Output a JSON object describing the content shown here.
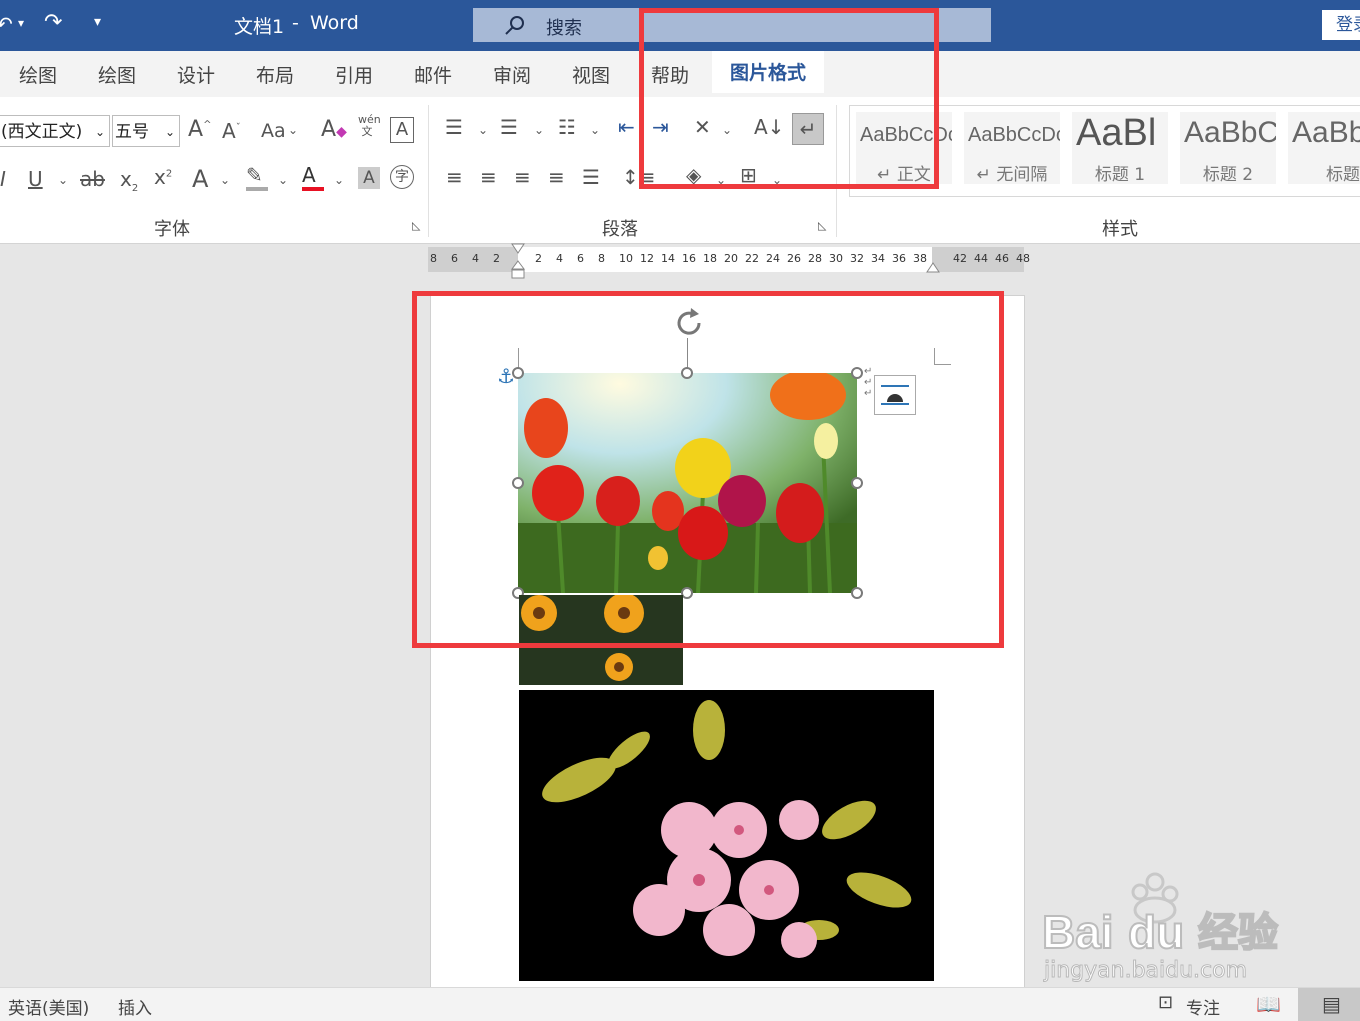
{
  "title_bar": {
    "doc_name": "文档1",
    "separator": "-",
    "app_name": "Word",
    "search_placeholder": "搜索",
    "login_label": "登录"
  },
  "tabs": [
    "绘图",
    "绘图",
    "设计",
    "布局",
    "引用",
    "邮件",
    "审阅",
    "视图",
    "帮助",
    "图片格式"
  ],
  "active_tab": "图片格式",
  "font_group": {
    "font_name": "(西文正文)",
    "font_size": "五号",
    "label": "字体",
    "case_button": "Aa",
    "phonetic": "wén"
  },
  "paragraph_group": {
    "label": "段落"
  },
  "styles_group": {
    "label": "样式",
    "styles": [
      {
        "preview": "AaBbCcDc",
        "name": "正文"
      },
      {
        "preview": "AaBbCcDc",
        "name": "无间隔"
      },
      {
        "preview": "AaBl",
        "name": "标题 1"
      },
      {
        "preview": "AaBbC",
        "name": "标题 2"
      },
      {
        "preview": "AaBb",
        "name": "标题"
      }
    ]
  },
  "ruler": {
    "left_ticks": [
      "8",
      "6",
      "4",
      "2"
    ],
    "mid_ticks": [
      "2",
      "4",
      "6",
      "8",
      "10",
      "12",
      "14",
      "16",
      "18",
      "20",
      "22",
      "24",
      "26",
      "28",
      "30",
      "32",
      "34",
      "36",
      "38"
    ],
    "right_ticks": [
      "42",
      "44",
      "46",
      "48"
    ]
  },
  "status_bar": {
    "language": "英语(美国)",
    "mode": "插入",
    "focus": "专注"
  },
  "watermark": {
    "brand": "Bai du 经验",
    "url": "jingyan.baidu.com"
  },
  "colors": {
    "title_blue": "#2b579a",
    "highlight_red": "#ee3a3d",
    "font_color_bar": "#e81123"
  },
  "icons": [
    "undo-icon",
    "redo-icon",
    "customize-icon",
    "search-icon",
    "anchor-icon",
    "layout-options-icon",
    "rotate-icon",
    "read-mode-icon",
    "print-layout-icon"
  ]
}
